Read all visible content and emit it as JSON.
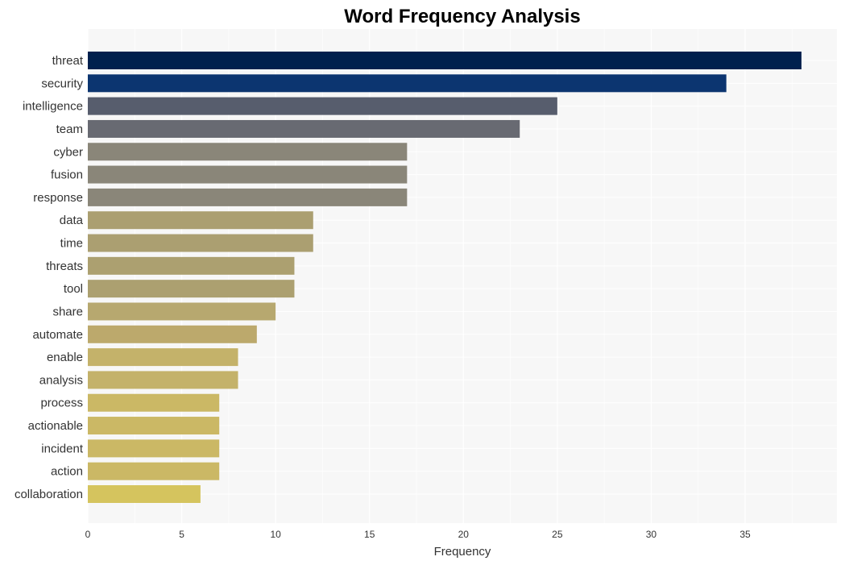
{
  "chart_data": {
    "type": "bar",
    "orientation": "horizontal",
    "title": "Word Frequency Analysis",
    "xlabel": "Frequency",
    "ylabel": "",
    "xlim": [
      0,
      39.8
    ],
    "xticks": [
      0,
      5,
      10,
      15,
      20,
      25,
      30,
      35
    ],
    "grid": true,
    "categories": [
      "threat",
      "security",
      "intelligence",
      "team",
      "cyber",
      "fusion",
      "response",
      "data",
      "time",
      "threats",
      "tool",
      "share",
      "automate",
      "enable",
      "analysis",
      "process",
      "actionable",
      "incident",
      "action",
      "collaboration"
    ],
    "values": [
      38,
      34,
      25,
      23,
      17,
      17,
      17,
      12,
      12,
      11,
      11,
      10,
      9,
      8,
      8,
      7,
      7,
      7,
      7,
      6
    ],
    "colors": [
      "#00204e",
      "#0c3570",
      "#575d6d",
      "#686a72",
      "#8a8679",
      "#8a8679",
      "#8a8679",
      "#ab9f71",
      "#ab9f71",
      "#aca070",
      "#aca070",
      "#b7a86f",
      "#bca96c",
      "#c4b26a",
      "#c4b26a",
      "#cbb865",
      "#cbb865",
      "#cbb865",
      "#cbb865",
      "#d5c45e"
    ]
  }
}
